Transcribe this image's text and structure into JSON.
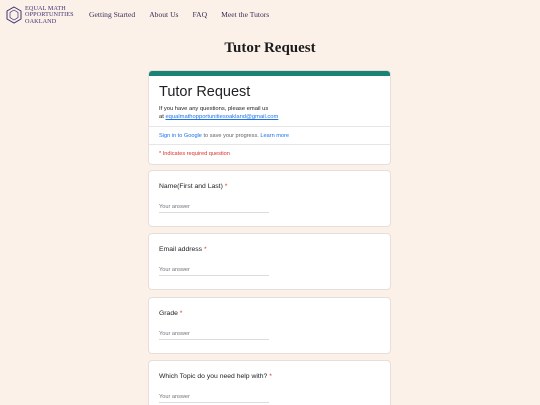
{
  "site": {
    "logo_lines": [
      "EQUAL MATH",
      "OPPORTUNITIES",
      "OAKLAND"
    ],
    "nav": [
      "Getting Started",
      "About Us",
      "FAQ",
      "Meet the Tutors"
    ]
  },
  "page_title": "Tutor Request",
  "form": {
    "title": "Tutor Request",
    "description_line1": "If you have any questions, please email us",
    "description_prefix": "at ",
    "email": "equalmathopportunitiesoakland@gmail.com",
    "signin_link": "Sign in to Google",
    "signin_text": " to save your progress. ",
    "learn_more": "Learn more",
    "required_note": "* Indicates required question",
    "questions": [
      {
        "label": "Name(First and Last)",
        "required": "*",
        "placeholder": "Your answer"
      },
      {
        "label": "Email address",
        "required": "*",
        "placeholder": "Your answer"
      },
      {
        "label": "Grade",
        "required": "*",
        "placeholder": "Your answer"
      },
      {
        "label": "Which Topic do you need help with?",
        "required": "*",
        "placeholder": "Your answer"
      }
    ]
  },
  "colors": {
    "accent": "#1a8376",
    "background": "#fcf1e9",
    "required": "#d93025",
    "link": "#1a73e8"
  }
}
